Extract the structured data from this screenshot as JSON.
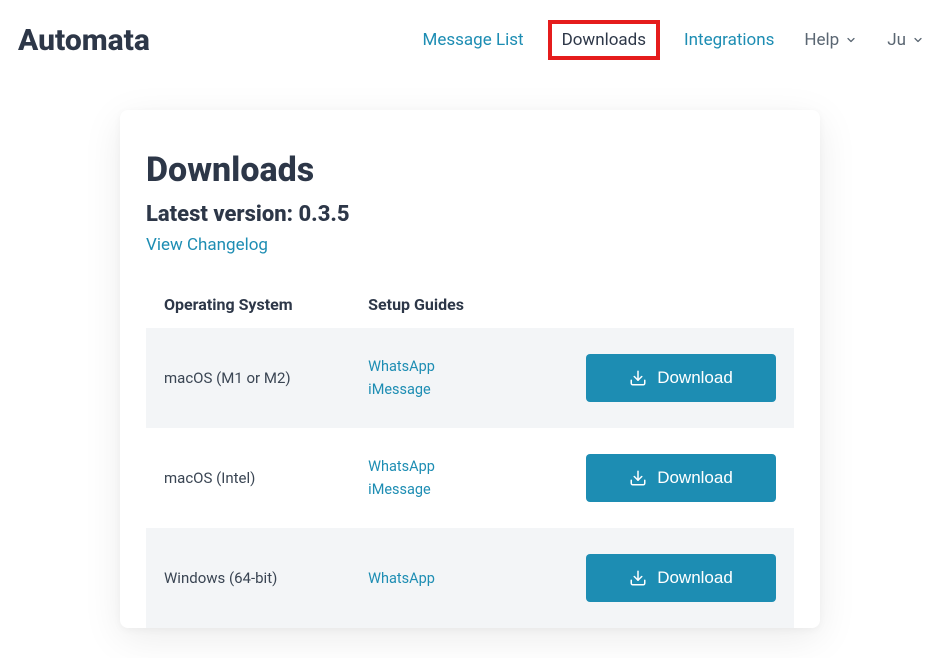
{
  "brand": "Automata",
  "nav": {
    "items": [
      {
        "label": "Message List",
        "active": false,
        "dropdown": false,
        "muted": false
      },
      {
        "label": "Downloads",
        "active": true,
        "dropdown": false,
        "muted": false
      },
      {
        "label": "Integrations",
        "active": false,
        "dropdown": false,
        "muted": false
      },
      {
        "label": "Help",
        "active": false,
        "dropdown": true,
        "muted": true
      },
      {
        "label": "Ju",
        "active": false,
        "dropdown": true,
        "muted": true
      }
    ]
  },
  "page": {
    "title": "Downloads",
    "latest_version_label": "Latest version: 0.3.5",
    "changelog_label": "View Changelog"
  },
  "table": {
    "headers": {
      "os": "Operating System",
      "guides": "Setup Guides"
    },
    "rows": [
      {
        "os": "macOS (M1 or M2)",
        "guides": [
          "WhatsApp",
          "iMessage"
        ],
        "button": "Download"
      },
      {
        "os": "macOS (Intel)",
        "guides": [
          "WhatsApp",
          "iMessage"
        ],
        "button": "Download"
      },
      {
        "os": "Windows (64-bit)",
        "guides": [
          "WhatsApp"
        ],
        "button": "Download"
      }
    ]
  }
}
